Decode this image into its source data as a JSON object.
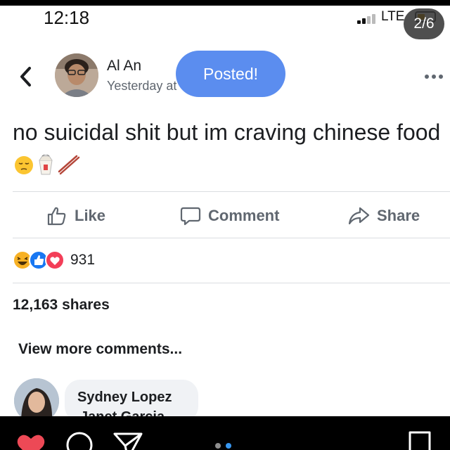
{
  "status_bar": {
    "time": "12:18",
    "network": "LTE",
    "page_counter": "2/6"
  },
  "post": {
    "author": "Al An",
    "timestamp": "Yesterday at",
    "toast": "Posted!",
    "text": "no suicidal shit but im craving chinese food",
    "emojis": [
      "pensive-face-emoji",
      "takeout-box-emoji",
      "chopsticks-emoji"
    ]
  },
  "actions": {
    "like": "Like",
    "comment": "Comment",
    "share": "Share"
  },
  "engagement": {
    "reactions": [
      "haha",
      "like",
      "love"
    ],
    "reaction_count": "931",
    "shares": "12,163 shares"
  },
  "comments": {
    "view_more": "View more comments...",
    "first_author": "Sydney Lopez",
    "first_text_partial": "Janet Garcia"
  },
  "colors": {
    "facebook_blue": "#1877f2",
    "toast_blue": "#5b8def",
    "love_red": "#f33e58",
    "haha_yellow": "#f7b125",
    "instagram_heart": "#ed4956"
  },
  "instagram_bar": {
    "icons": [
      "heart-icon",
      "comment-icon",
      "send-icon",
      "bookmark-icon"
    ],
    "carousel_dots": 2,
    "active_dot": 1
  }
}
